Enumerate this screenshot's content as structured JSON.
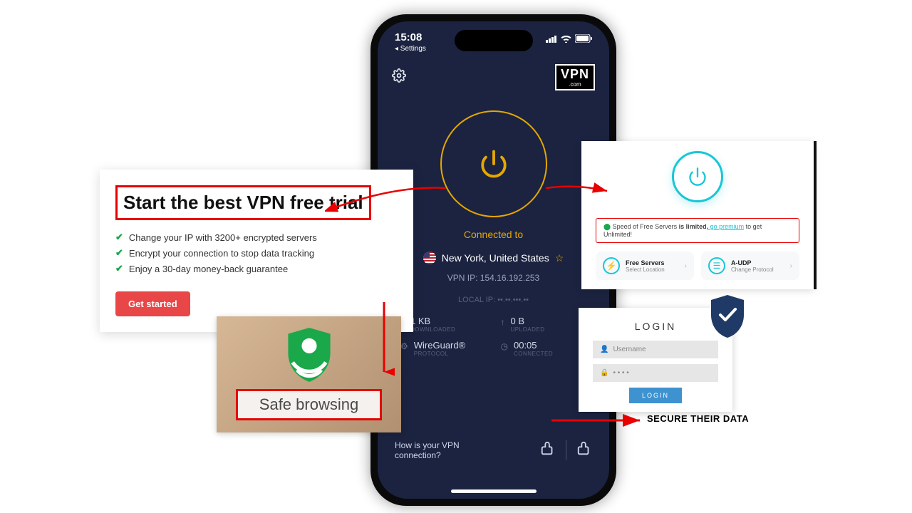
{
  "phone": {
    "status": {
      "time": "15:08",
      "back": "◂ Settings"
    },
    "logo_main": "VPN",
    "logo_sub": ".com",
    "connected_label": "Connected to",
    "location": "New York, United States",
    "vpn_ip": "VPN IP: 154.16.192.253",
    "local_ip": "LOCAL IP: ••.••.•••.••",
    "stats": {
      "download_value": "1 KB",
      "download_label": "DOWNLOADED",
      "upload_value": "0 B",
      "upload_label": "UPLOADED",
      "protocol_value": "WireGuard®",
      "protocol_label": "PROTOCOL",
      "time_value": "00:05",
      "time_label": "CONNECTED"
    },
    "feedback_question": "How is your VPN connection?"
  },
  "left_card": {
    "headline": "Start the best VPN free trial",
    "bullets": [
      "Change your IP with 3200+ encrypted servers",
      "Encrypt your connection to stop data tracking",
      "Enjoy a 30-day money-back guarantee"
    ],
    "cta": "Get started"
  },
  "safe": {
    "label": "Safe browsing"
  },
  "right_vpn": {
    "speed_pre": "Speed of Free Servers ",
    "speed_bold": "is limited,",
    "speed_link": " go premium",
    "speed_post": " to get Unlimited!",
    "tile1_title": "Free Servers",
    "tile1_sub": "Select Location",
    "tile2_title": "A-UDP",
    "tile2_sub": "Change Protocol"
  },
  "login": {
    "title": "LOGIN",
    "username": "Username",
    "password": "• • • •",
    "button": "LOGIN"
  },
  "secure_text": "SECURE THEIR DATA"
}
